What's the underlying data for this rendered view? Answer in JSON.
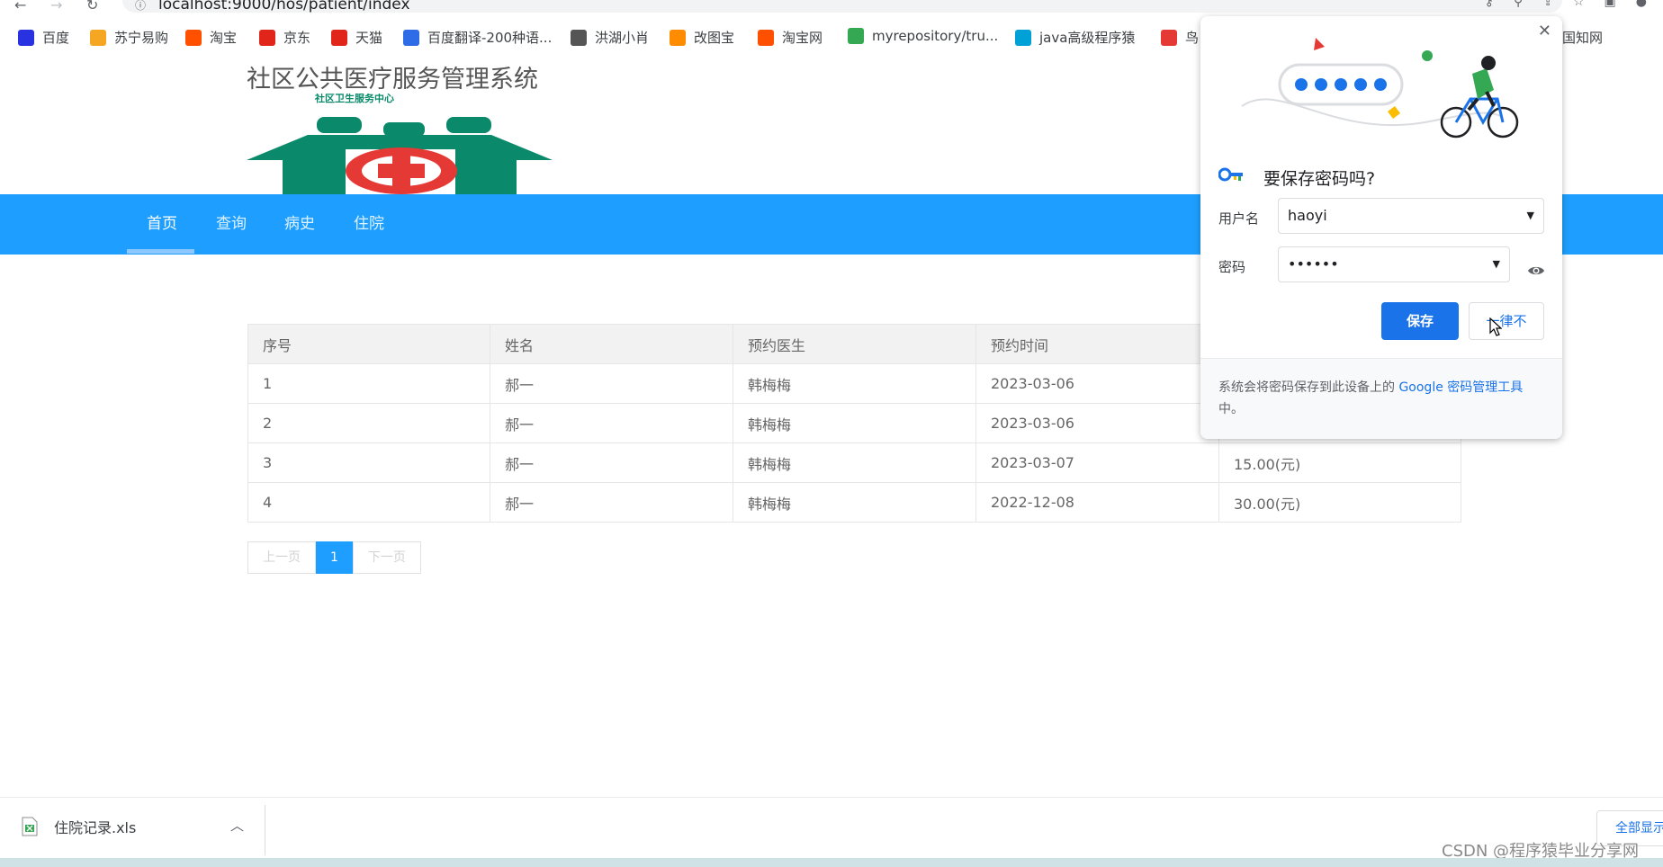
{
  "browser": {
    "url": "localhost:9000/hos/patient/index",
    "bookmarks": [
      {
        "label": "百度",
        "icon": "baidu-icon",
        "color": "#2932e1"
      },
      {
        "label": "苏宁易购",
        "icon": "suning-icon",
        "color": "#f5a623"
      },
      {
        "label": "淘宝",
        "icon": "taobao-icon",
        "color": "#ff5000"
      },
      {
        "label": "京东",
        "icon": "jd-icon",
        "color": "#e1251b"
      },
      {
        "label": "天猫",
        "icon": "tmall-icon",
        "color": "#e1251b"
      },
      {
        "label": "百度翻译-200种语...",
        "icon": "translate-icon",
        "color": "#2e6be6"
      },
      {
        "label": "洪湖小肖",
        "icon": "bird-icon",
        "color": "#555555"
      },
      {
        "label": "改图宝",
        "icon": "gaitubao-icon",
        "color": "#ff8c00"
      },
      {
        "label": "淘宝网",
        "icon": "taobao-icon",
        "color": "#ff5000"
      },
      {
        "label": "myrepository/tru...",
        "icon": "chrome-icon",
        "color": "#34a853"
      },
      {
        "label": "java高级程序猿",
        "icon": "bilibili-icon",
        "color": "#00a1d6"
      },
      {
        "label": "鸟",
        "icon": "bird-red-icon",
        "color": "#e53935"
      },
      {
        "label": "中国知网",
        "icon": "cnki-icon",
        "color": "#1a5fb4"
      }
    ]
  },
  "site": {
    "title": "社区公共医疗服务管理系统",
    "logo_caption": "社区卫生服务中心"
  },
  "nav": {
    "items": [
      "首页",
      "查询",
      "病史",
      "住院"
    ],
    "active_index": 0
  },
  "table": {
    "headers": [
      "序号",
      "姓名",
      "预约医生",
      "预约时间",
      ""
    ],
    "rows": [
      [
        "1",
        "郝一",
        "韩梅梅",
        "2023-03-06",
        ""
      ],
      [
        "2",
        "郝一",
        "韩梅梅",
        "2023-03-06",
        ""
      ],
      [
        "3",
        "郝一",
        "韩梅梅",
        "2023-03-07",
        "15.00(元)"
      ],
      [
        "4",
        "郝一",
        "韩梅梅",
        "2022-12-08",
        "30.00(元)"
      ]
    ]
  },
  "pager": {
    "prev": "上一页",
    "current": "1",
    "next": "下一页"
  },
  "password_popup": {
    "title": "要保存密码吗?",
    "username_label": "用户名",
    "username_value": "haoyi",
    "password_label": "密码",
    "password_value": "••••••",
    "save_label": "保存",
    "never_label": "一律不",
    "footer_prefix": "系统会将密码保存到此设备上的 ",
    "footer_link": "Google 密码管理工具",
    "footer_suffix": "中。"
  },
  "download_bar": {
    "file_name": "住院记录.xls",
    "show_all": "全部显示"
  },
  "watermark": "CSDN @程序猿毕业分享网",
  "colors": {
    "nav_blue": "#1e9fff",
    "google_blue": "#1a73e8",
    "logo_green": "#0a8a6a",
    "logo_red": "#e53935"
  }
}
